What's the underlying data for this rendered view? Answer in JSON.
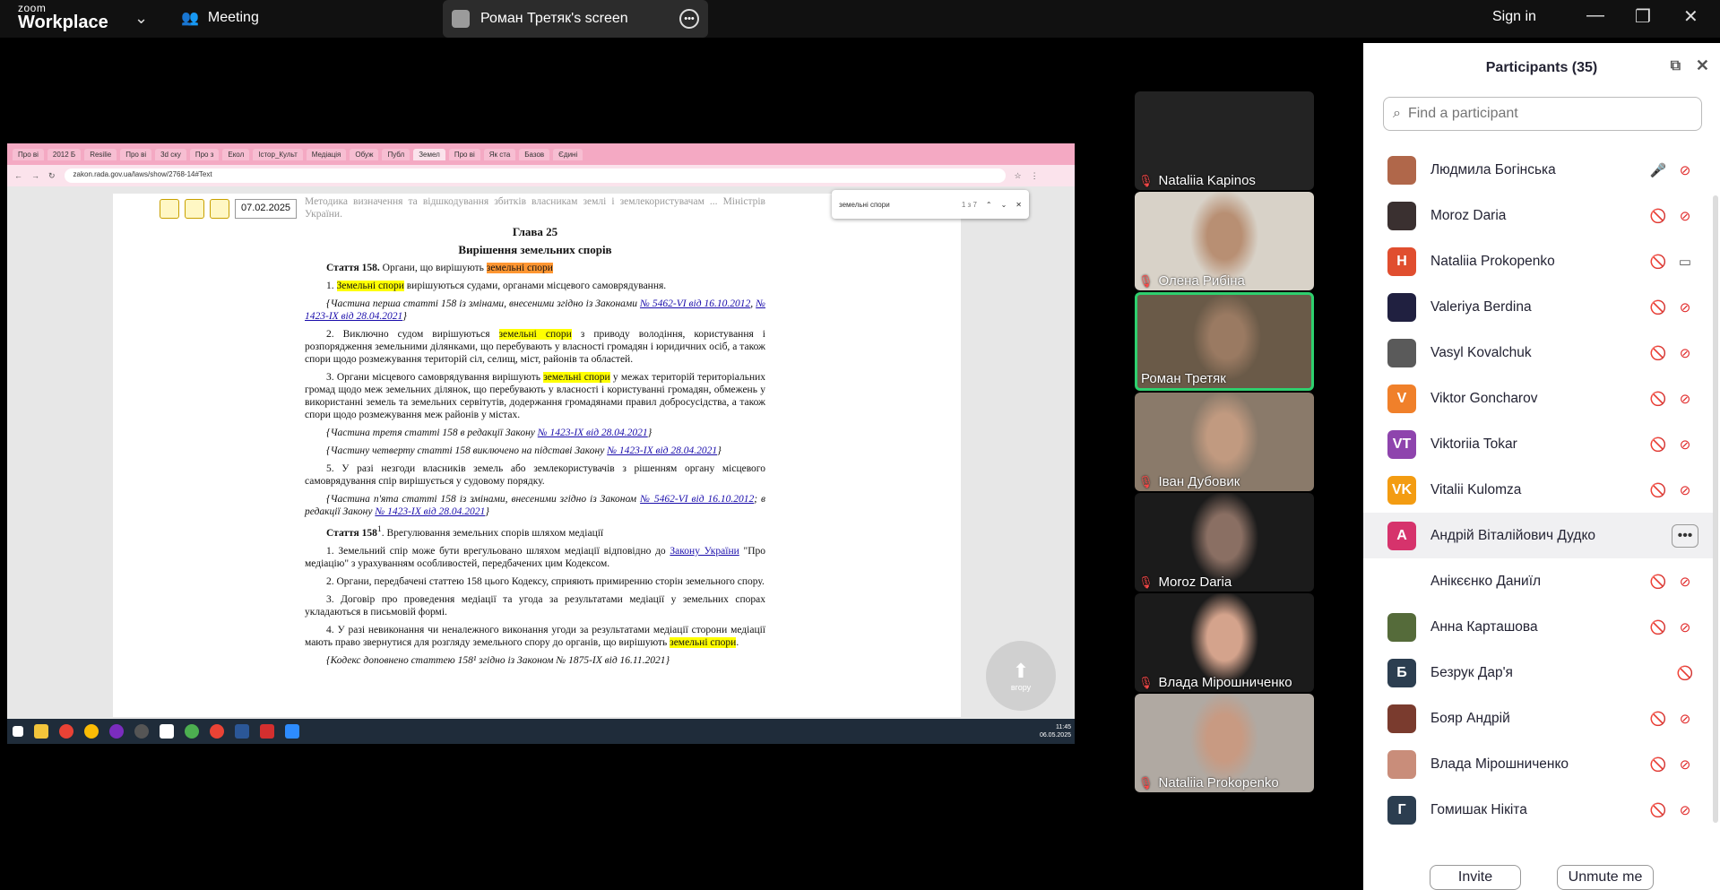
{
  "topbar": {
    "logo_line1": "zoom",
    "logo_line2": "Workplace",
    "meeting_label": "Meeting",
    "screen_title": "Роман Третяк's screen",
    "signin": "Sign in",
    "chevron_icon": "chevron-down-icon",
    "people_icon": "people-icon"
  },
  "shared": {
    "tabs": [
      "Про ві",
      "2012 Б",
      "Resilie",
      "Про ві",
      "3d ску",
      "Про з",
      "Екол",
      "Істор_Культ",
      "Медіація",
      "Обуж",
      "Публ",
      "Земел",
      "Про ві",
      "Як ста",
      "Базов",
      "Єдині"
    ],
    "active_tab": 11,
    "url": "zakon.rada.gov.ua/laws/show/2768-14#Text",
    "date_select": "07.02.2025",
    "find_query": "земельні спори",
    "find_count": "1 з 7",
    "up_label": "вгору",
    "taskbar_time": "11:45",
    "taskbar_date": "06.05.2025",
    "doc": {
      "top_frag": "Методика визначення та відшкодування збитків власникам землі і землекористувачам ... Міністрів України.",
      "chapter": "Глава 25",
      "chapter_title": "Вирішення земельних спорів",
      "art158_head": "Стаття 158.",
      "art158_title": " Органи, що вирішують ",
      "art158_hl": "земельні спори",
      "p1_hl": "Земельні спори",
      "p1_rest": " вирішуються судами, органами місцевого самоврядування.",
      "p1_prefix": "1. ",
      "note1": "{Частина перша статті 158 із змінами, внесеними згідно із Законами ",
      "note1_l1": "№ 5462-VI від 16.10.2012",
      "note1_l2": "№ 1423-IX від 28.04.2021",
      "p2_a": "2. Виключно судом вирішуються ",
      "p2_hl": "земельні спори",
      "p2_b": " з приводу володіння, користування і розпорядження земельними ділянками, що перебувають у власності громадян і юридичних осіб, а також спори щодо розмежування територій сіл, селищ, міст, районів та областей.",
      "p3_a": "3. Органи місцевого самоврядування вирішують ",
      "p3_hl": "земельні спори",
      "p3_b": " у межах територій територіальних громад щодо меж земельних ділянок, що перебувають у власності і користуванні громадян, обмежень у використанні земель та земельних сервітутів, додержання громадянами правил добросусідства, а також спори щодо розмежування меж районів у містах.",
      "note3": "{Частина третя статті 158 в редакції Закону ",
      "note3_l": "№ 1423-IX від 28.04.2021",
      "note4": "{Частину четверту статті 158 виключено на підставі Закону ",
      "note4_l": "№ 1423-IX від 28.04.2021",
      "p5": "5. У разі незгоди власників земель або землекористувачів з рішенням органу місцевого самоврядування спір вирішується у судовому порядку.",
      "note5": "{Частина п'ята статті 158 із змінами, внесеними згідно із Законом ",
      "note5_l1": "№ 5462-VI від 16.10.2012",
      "note5_mid": "; в редакції Закону ",
      "note5_l2": "№ 1423-IX від 28.04.2021",
      "art1581_head": "Стаття 158",
      "art1581_sup": "1",
      "art1581_title": ". Врегулювання земельних спорів шляхом медіації",
      "m1_a": "1. Земельний спір може бути врегульовано шляхом медіації відповідно до ",
      "m1_l": "Закону України",
      "m1_b": " \"Про медіацію\" з урахуванням особливостей, передбачених цим Кодексом.",
      "m2": "2. Органи, передбачені статтею 158 цього Кодексу, сприяють примиренню сторін земельного спору.",
      "m3": "3. Договір про проведення медіації та угода за результатами медіації у земельних спорах укладаються в письмовій формі.",
      "m4_a": "4. У разі невиконання чи неналежного виконання угоди за результатами медіації сторони медіації мають право звернутися для розгляду земельного спору до органів, що вирішують ",
      "m4_hl": "земельні спори",
      "m4_b": ".",
      "last": "{Кодекс доповнено статтею 158¹ згідно із Законом № 1875-IX від 16.11.2021}"
    }
  },
  "videos": [
    {
      "name": "Nataliia Kapinos",
      "bg": "#232323",
      "face": ""
    },
    {
      "name": "Олена Рибіна",
      "bg": "#d8d2c8",
      "face": "#b88f73"
    },
    {
      "name": "Роман Третяк",
      "bg": "#6a5a48",
      "face": "#9a7a62",
      "active": true
    },
    {
      "name": "Іван Дубовик",
      "bg": "#8a7a6a",
      "face": "#c19a80"
    },
    {
      "name": "Moroz Daria",
      "bg": "#1b1b1b",
      "face": "#8a6f63"
    },
    {
      "name": "Влада Мірошниченко",
      "bg": "#1b1b1b",
      "face": "#d4a38c"
    },
    {
      "name": "Nataliia Prokopenko",
      "bg": "#b0a9a2",
      "face": "#c89a82"
    }
  ],
  "participants": {
    "title": "Participants (35)",
    "search_placeholder": "Find a participant",
    "invite": "Invite",
    "unmute": "Unmute me",
    "rows": [
      {
        "name": "Людмила Богінська",
        "initials": "",
        "color": "#b0674a",
        "mic": "mic-on",
        "video": "video-off"
      },
      {
        "name": "Moroz Daria",
        "initials": "",
        "color": "#3a3030",
        "mic": "mic-off",
        "video": "video-off"
      },
      {
        "name": "Nataliia Prokopenko",
        "initials": "H",
        "color": "#e04e2f",
        "mic": "mic-off",
        "video": "video-on"
      },
      {
        "name": "Valeriya Berdina",
        "initials": "",
        "color": "#202040",
        "mic": "mic-off",
        "video": "video-off"
      },
      {
        "name": "Vasyl Kovalchuk",
        "initials": "",
        "color": "#5a5a5a",
        "mic": "mic-off",
        "video": "video-off"
      },
      {
        "name": "Viktor Goncharov",
        "initials": "V",
        "color": "#f0802a",
        "mic": "mic-off",
        "video": "video-off"
      },
      {
        "name": "Viktoriia Tokar",
        "initials": "VT",
        "color": "#8e44ad",
        "mic": "mic-off",
        "video": "video-off"
      },
      {
        "name": "Vitalii Kulomza",
        "initials": "VK",
        "color": "#f39c12",
        "mic": "mic-off",
        "video": "video-off"
      },
      {
        "name": "Андрій Віталійович Дудко",
        "initials": "A",
        "color": "#d6336c",
        "mic": "",
        "video": "",
        "hover": true
      },
      {
        "name": "Анікєєнко Даниїл",
        "initials": "",
        "color": "#ffffff",
        "mic": "mic-off",
        "video": "video-off"
      },
      {
        "name": "Анна Карташова",
        "initials": "",
        "color": "#556b3a",
        "mic": "mic-off",
        "video": "video-off"
      },
      {
        "name": "Безрук Дар'я",
        "initials": "Б",
        "color": "#2c3e50",
        "mic": "mic-off",
        "video": ""
      },
      {
        "name": "Бояр Андрій",
        "initials": "",
        "color": "#7a3b2e",
        "mic": "mic-off",
        "video": "video-off"
      },
      {
        "name": "Влада Мірошниченко",
        "initials": "",
        "color": "#c98d7a",
        "mic": "mic-off",
        "video": "video-off"
      },
      {
        "name": "Гомишак Нікіта",
        "initials": "Г",
        "color": "#2c3e50",
        "mic": "mic-off",
        "video": "video-off"
      }
    ]
  }
}
